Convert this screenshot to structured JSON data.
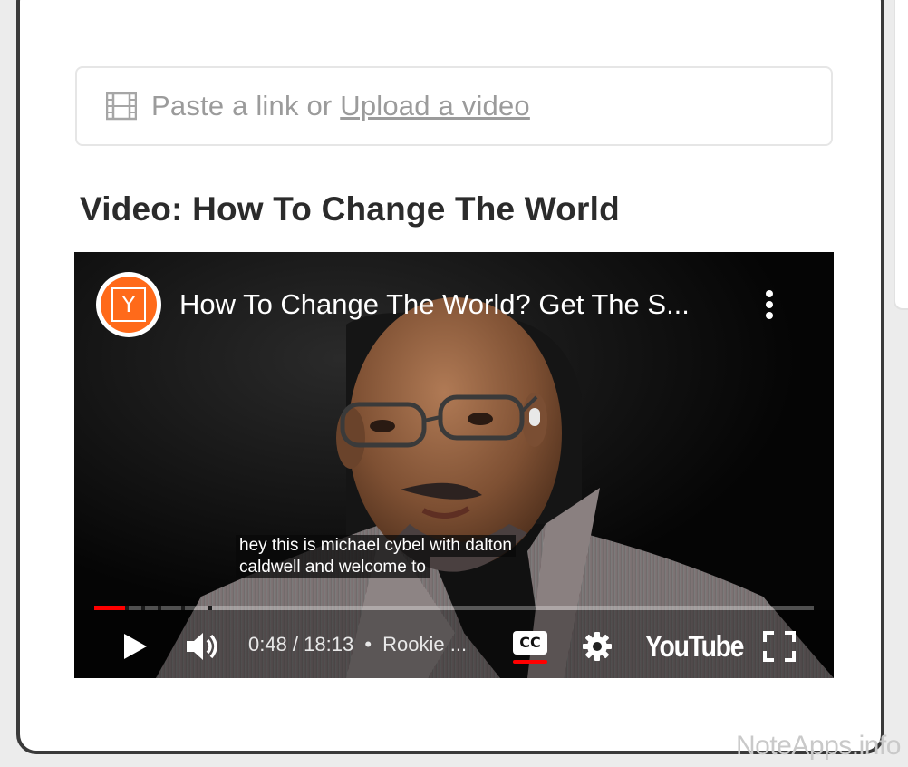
{
  "editor": {
    "link_prompt": "Paste a link or ",
    "upload_label": "Upload a video",
    "video_heading": "Video: How To Change The World"
  },
  "player": {
    "channel_avatar_letter": "Y",
    "video_title": "How To Change The World? Get The S...",
    "caption_line1": "hey this is michael cybel with dalton",
    "caption_line2": "caldwell and welcome to",
    "time_display": "0:48 / 18:13",
    "chapter_separator": "•",
    "chapter_label": "Rookie ...",
    "cc_label": "CC",
    "logo_text": "YouTube",
    "progress_played_fraction": 0.045,
    "colors": {
      "progress": "#ff0000",
      "cc_underline": "#ff0000",
      "avatar": "#ff6a1a"
    }
  },
  "footer": {
    "watermark": "NoteApps.info"
  }
}
